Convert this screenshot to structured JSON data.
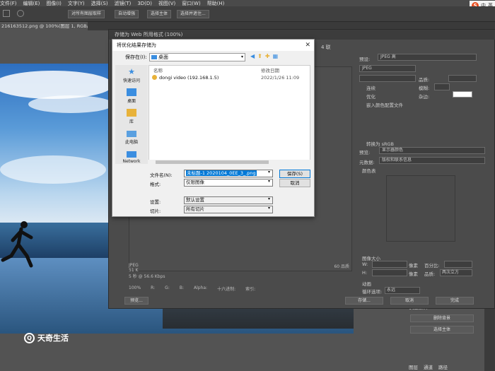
{
  "menubar": {
    "items": [
      "文件(F)",
      "编辑(E)",
      "图像(I)",
      "文字(Y)",
      "选择(S)",
      "滤镜(T)",
      "3D(D)",
      "视图(V)",
      "窗口(W)",
      "帮助(H)"
    ],
    "ime": [
      "S",
      "中",
      "英"
    ]
  },
  "optionbar": {
    "buttons": [
      "对所有图层取样",
      "自动增强",
      "选择主体",
      "选择并遮住..."
    ]
  },
  "document_tab": {
    "label": "216163512.png @ 100%(图层 1, RGB/8#)"
  },
  "sfw": {
    "title": "存储为 Web 所用格式 (100%)",
    "tab_label": "4 联",
    "right_labels": {
      "preset": "预设:",
      "preset_value": "JPEG 高",
      "format": "JPEG",
      "quality_label": "品质:",
      "blur_label": "模糊:",
      "matte_label": "杂边:",
      "progressive": "连续",
      "optimized": "优化",
      "embed_profile": "嵌入颜色配置文件",
      "convert_srgb": "转换为 sRGB",
      "preview_label": "预览:",
      "preview_value": "显示器颜色",
      "metadata_label": "元数据:",
      "metadata_value": "版权和联系信息",
      "color_table": "颜色表",
      "image_size": "图像大小",
      "w_label": "W:",
      "h_label": "H:",
      "percent_label": "百分比:",
      "px": "像素",
      "quality_value": "两次立方",
      "animation": "动画",
      "loop_label": "循环选项:",
      "loop_value": "永远"
    },
    "status_lines": [
      "JPEG",
      "51 K",
      "5 秒 @ 56.6 Kbps"
    ],
    "status_right": "60 品质",
    "bottom": {
      "zoom": "100%",
      "r": "R:",
      "g": "G:",
      "b": "B:",
      "alpha": "Alpha:",
      "hex": "十六进制:",
      "index": "索引:"
    },
    "buttons": {
      "preview": "预览...",
      "save": "存储...",
      "cancel": "取消",
      "done": "完成"
    }
  },
  "right_panel": {
    "quick_actions": "快速操作",
    "remove_bg": "删除背景",
    "select_subject": "选择主体",
    "bottom_tabs": [
      "图层",
      "通道",
      "路径"
    ]
  },
  "file_dialog": {
    "title": "将优化结果存储为",
    "close": "✕",
    "save_in_label": "保存在(I):",
    "save_in_value": "桌面",
    "nav": [
      "快速访问",
      "桌面",
      "库",
      "此电脑",
      "Network"
    ],
    "columns": {
      "name": "名称",
      "modified": "修改日期"
    },
    "rows": [
      {
        "name": "dongi video (192.168.1.5)",
        "modified": "2022/1/26 11:09"
      }
    ],
    "filename_label": "文件名(N):",
    "filename_value": "未标题-1 2020104_0EE_3_.png",
    "format_label": "格式:",
    "format_value": "仅限图像",
    "settings_label": "设置:",
    "settings_value": "默认设置",
    "slices_label": "切片:",
    "slices_value": "所有切片",
    "save_button": "保存(S)",
    "cancel_button": "取消"
  },
  "watermark": {
    "text": "天奇生活",
    "icon": "Q"
  }
}
